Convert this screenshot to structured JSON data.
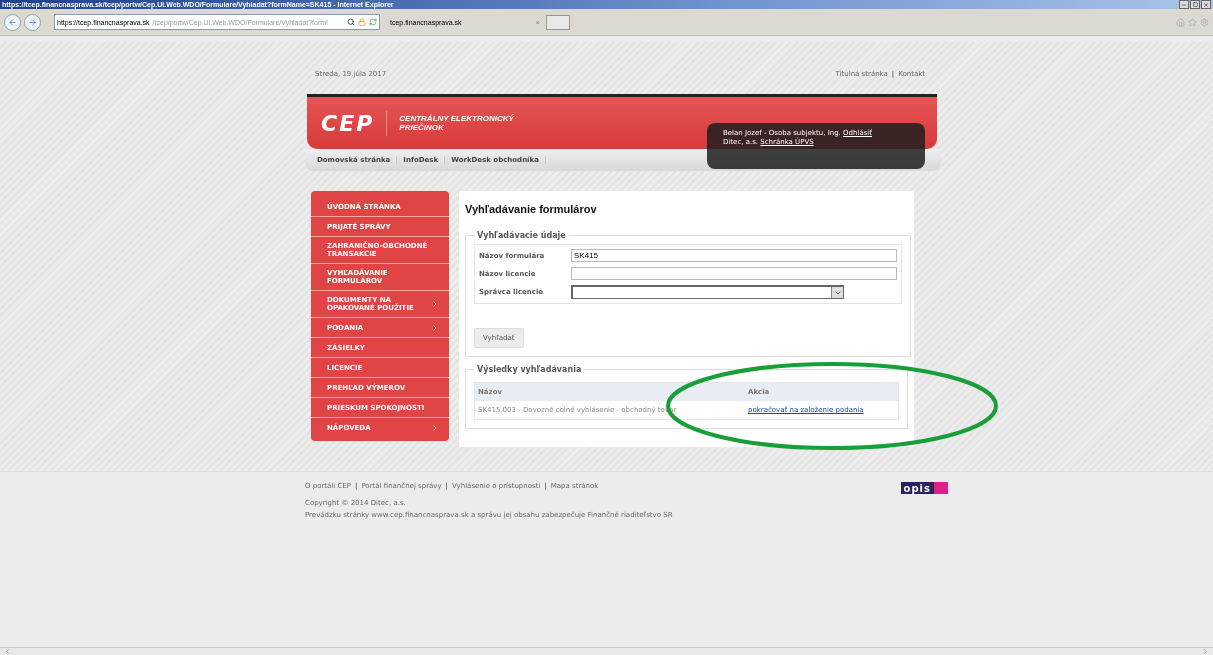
{
  "window": {
    "title": "https://tcep.financnasprava.sk/tcep/portw/Cep.Ui.Web.WDO/Formulare/Vyhladat?formName=SK415 - Internet Explorer"
  },
  "browser": {
    "address_host": "https://tcep.financnasprava.sk",
    "address_path": "/tcep/portw/Cep.Ui.Web.WDO/Formulare/Vyhladat?form!",
    "tab": {
      "label": "tcep.financnasprava.sk",
      "close": "×"
    }
  },
  "header": {
    "date": "Streda, 19.júla 2017",
    "top_links": [
      "Titulná stránka",
      "Kontakt"
    ],
    "link_separator": "|",
    "logo": "CEP",
    "title_lines": [
      "CENTRÁLNY ELEKTRONICKÝ",
      "PRIEČINOK"
    ],
    "user": {
      "name": "Belan Jozef - Osoba subjektu, Ing.",
      "logout": "Odhlásiť",
      "org": "Ditec, a.s.",
      "mailbox": "Schránka ÚPVS"
    },
    "nav": [
      "Domovská stránka",
      "InfoDesk",
      "WorkDesk obchodníka"
    ]
  },
  "sidebar": {
    "items": [
      {
        "label": "ÚVODNÁ STRÁNKA",
        "submenu": false
      },
      {
        "label": "PRIJATÉ SPRÁVY",
        "submenu": false
      },
      {
        "label": "ZAHRANIČNO-OBCHODNÉ TRANSAKCIE",
        "submenu": false
      },
      {
        "label": "VYHĽADÁVANIE FORMULÁROV",
        "submenu": false
      },
      {
        "label": "DOKUMENTY NA OPAKOVANÉ POUŽITIE",
        "submenu": true
      },
      {
        "label": "PODANIA",
        "submenu": true
      },
      {
        "label": "ZÁSIELKY",
        "submenu": false
      },
      {
        "label": "LICENCIE",
        "submenu": false
      },
      {
        "label": "PREHĽAD VÝMEROV",
        "submenu": false
      },
      {
        "label": "PRIESKUM SPOKOJNOSTI",
        "submenu": false
      },
      {
        "label": "NÁPOVEDA",
        "submenu": true
      }
    ]
  },
  "content": {
    "heading": "Vyhľadávanie formulárov",
    "search": {
      "legend": "Vyhľadávacie údaje",
      "fields": [
        {
          "label": "Názov formulára",
          "kind": "text",
          "value": "SK415"
        },
        {
          "label": "Názov licencie",
          "kind": "text"
        },
        {
          "label": "Správca licencie",
          "kind": "select"
        }
      ],
      "button": "Vyhľadať"
    },
    "results": {
      "legend": "Výsledky vyhľadávania",
      "columns": [
        "Názov",
        "Akcia"
      ],
      "rows": [
        {
          "name": "SK415.003 - Dovozné colné vyhlásenie - obchodný tovar",
          "action": "pokračovať na založenie podania"
        }
      ]
    }
  },
  "footer": {
    "links": [
      "O portáli CEP",
      "Portál finančnej správy",
      "Vyhlásenie o prístupnosti",
      "Mapa stránok"
    ],
    "link_separator": "|",
    "copyright": "Copyright © 2014 Ditec, a.s.",
    "operator": "Prevádzku stránky www.cep.financnasprava.sk a správu jej obsahu zabezpečuje Finančné riaditeľstvo SR",
    "logo": "opis"
  }
}
